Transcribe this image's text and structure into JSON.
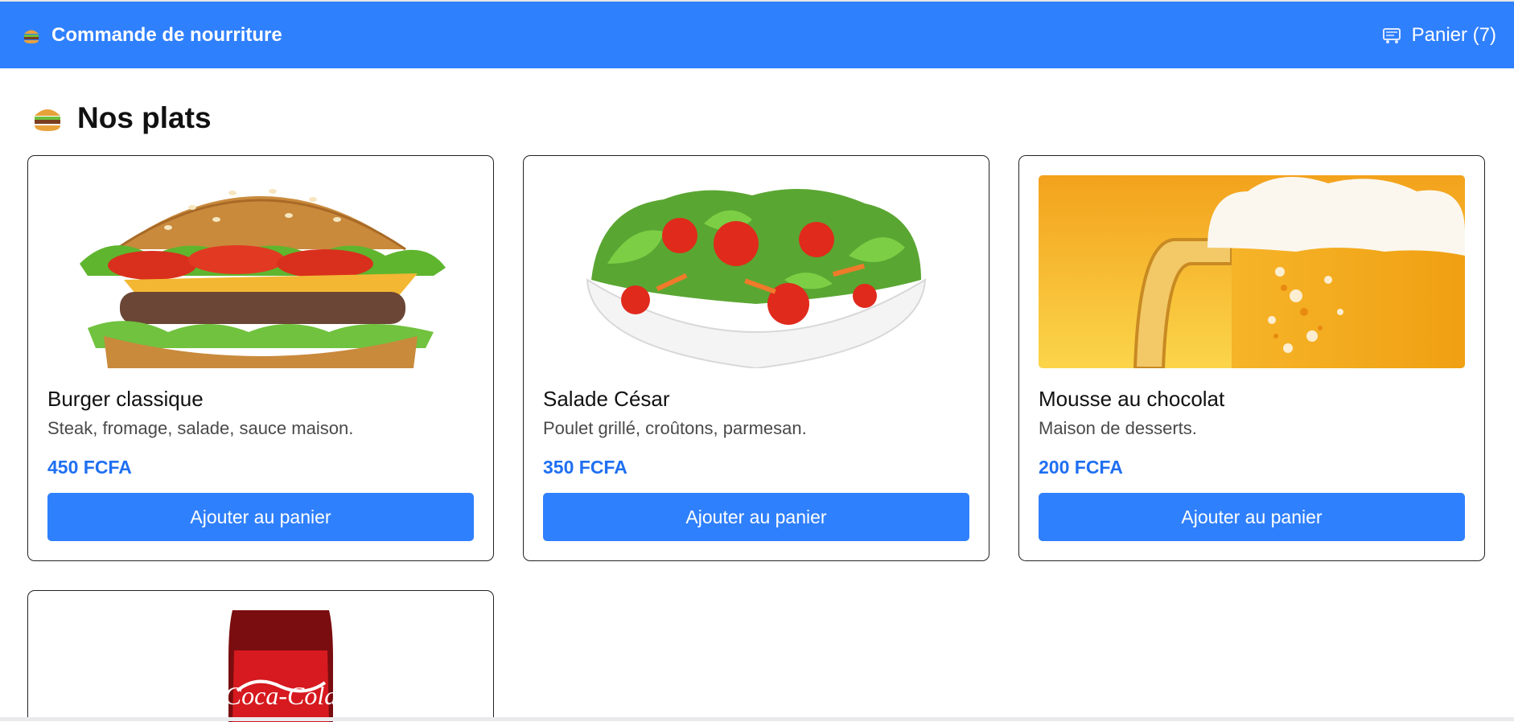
{
  "navbar": {
    "brand_icon": "burger-icon",
    "brand_title": "Commande de nourriture",
    "cart_icon": "cart-icon",
    "cart_label": "Panier (7)",
    "background_color": "#2f80fd"
  },
  "main": {
    "title_icon": "burger-icon",
    "title": "Nos plats"
  },
  "products": [
    {
      "image": "burger-image",
      "name": "Burger classique",
      "description": "Steak, fromage, salade, sauce maison.",
      "price": "450 FCFA",
      "button_label": "Ajouter au panier"
    },
    {
      "image": "salad-image",
      "name": "Salade César",
      "description": "Poulet grillé, croûtons, parmesan.",
      "price": "350 FCFA",
      "button_label": "Ajouter au panier"
    },
    {
      "image": "beer-image",
      "name": "Mousse au chocolat",
      "description": "Maison de desserts.",
      "price": "200 FCFA",
      "button_label": "Ajouter au panier"
    },
    {
      "image": "coca-cola-bottle-image"
    }
  ],
  "colors": {
    "accent": "#2f80fd",
    "price": "#1f6ff2"
  }
}
